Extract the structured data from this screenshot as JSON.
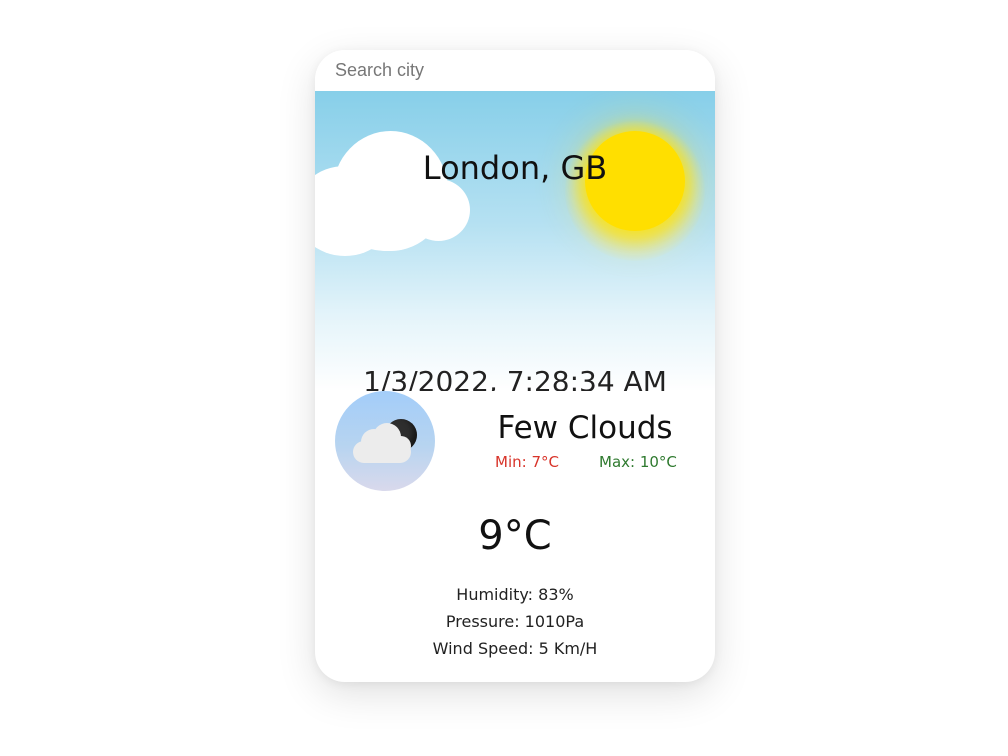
{
  "search": {
    "placeholder": "Search city",
    "value": ""
  },
  "location": {
    "city": "London, GB"
  },
  "datetime": "1/3/2022, 7:28:34 AM",
  "weather": {
    "icon": "few-clouds-night-icon",
    "condition": "Few Clouds",
    "min_label": "Min: 7°C",
    "max_label": "Max: 10°C",
    "temperature": "9°C",
    "humidity": "Humidity: 83%",
    "pressure": "Pressure: 1010Pa",
    "wind_speed": "Wind Speed: 5 Km/H"
  },
  "colors": {
    "sky_top": "#87cfe9",
    "sun": "#ffdf00",
    "min_temp": "#d8342a",
    "max_temp": "#2f7a2f"
  }
}
